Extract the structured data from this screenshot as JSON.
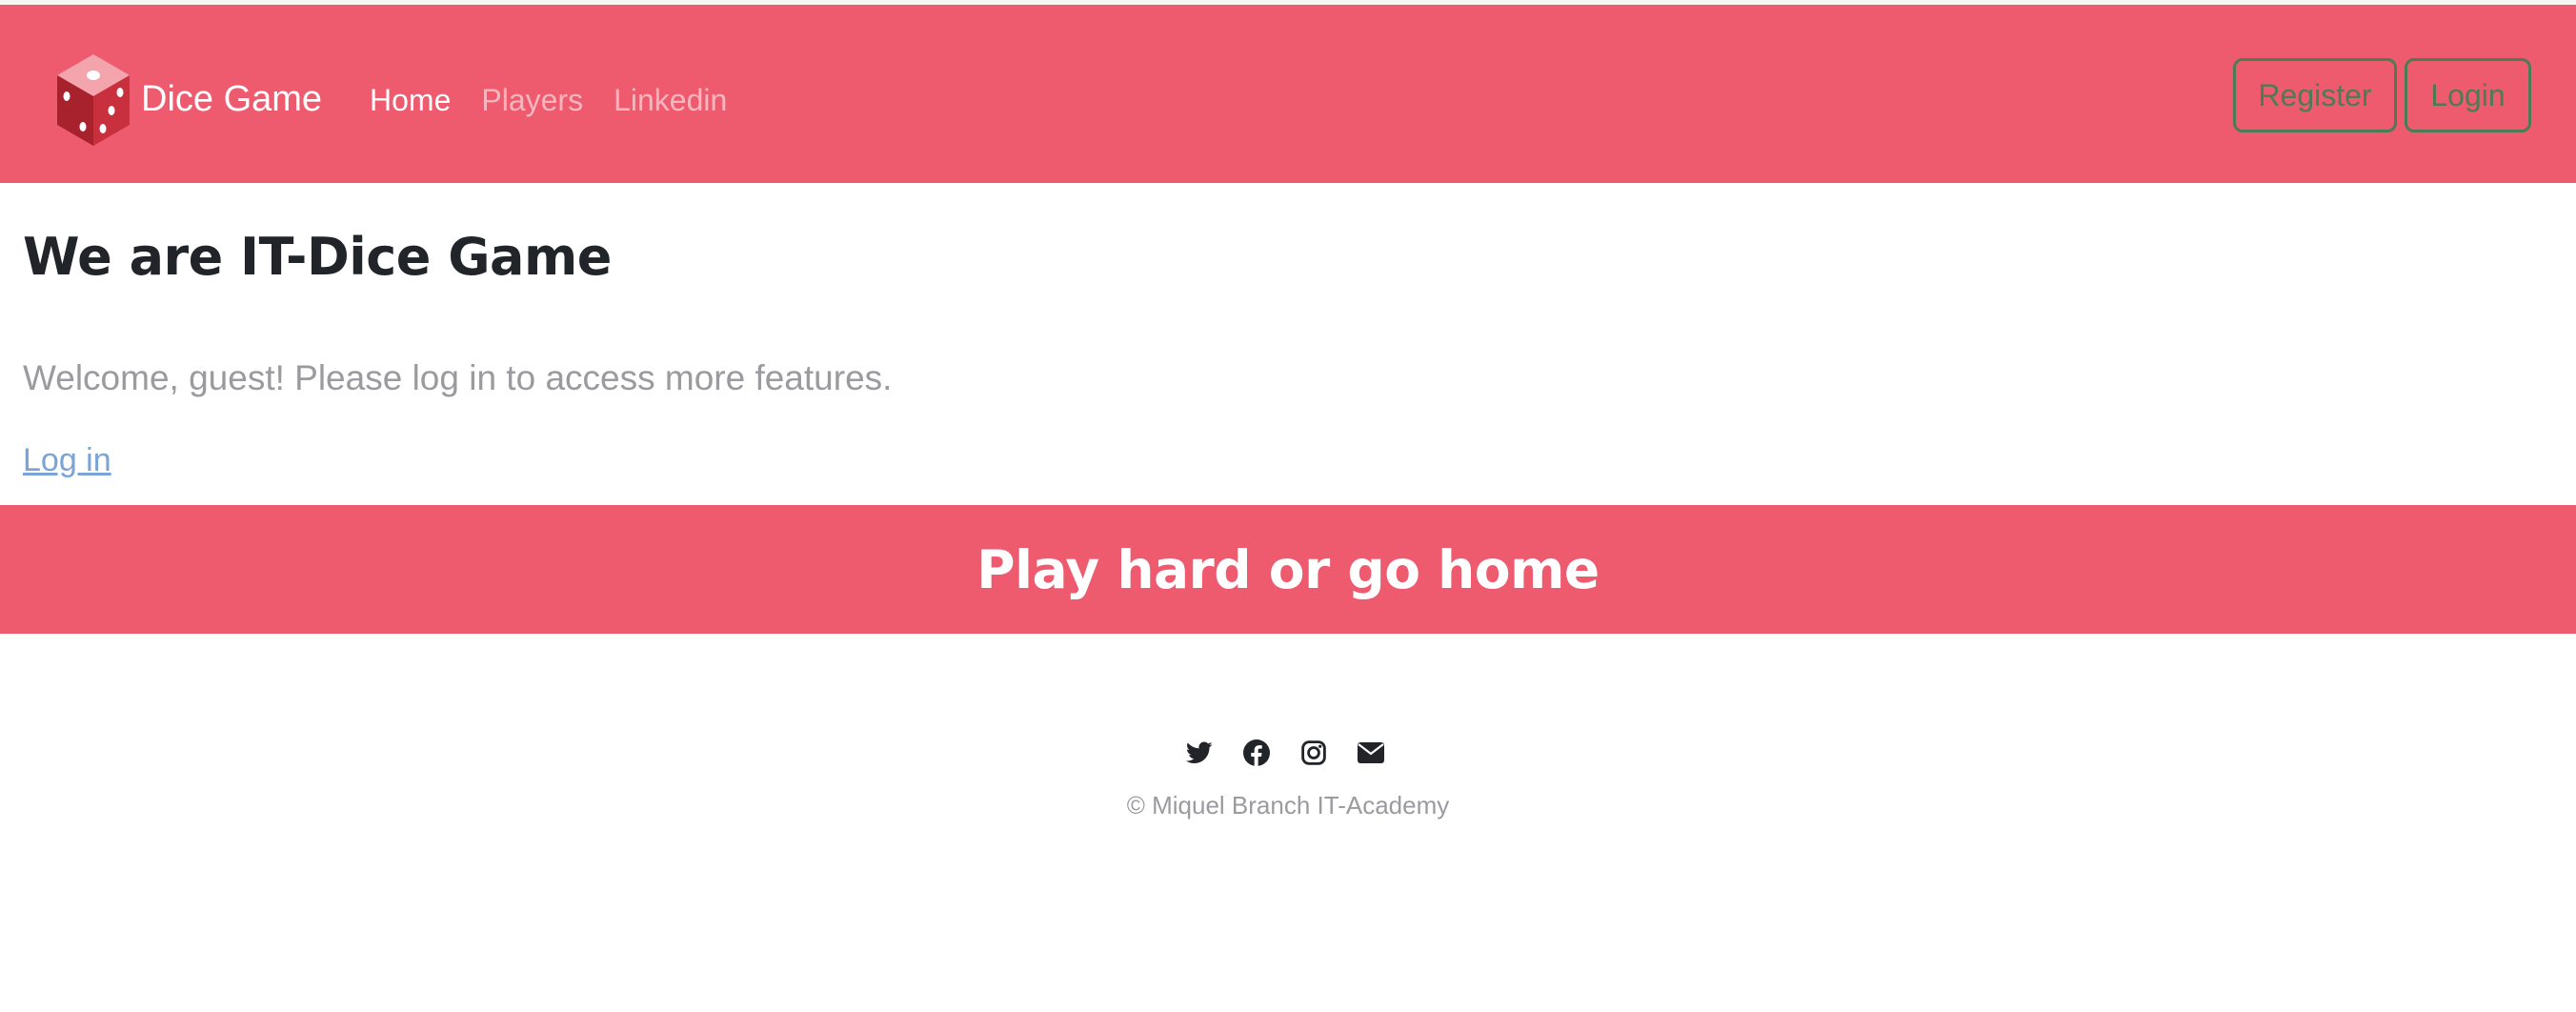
{
  "brand": {
    "name": "Dice Game",
    "logo_icon": "dice-icon"
  },
  "nav": {
    "links": [
      {
        "label": "Home",
        "active": true
      },
      {
        "label": "Players",
        "active": false
      },
      {
        "label": "Linkedin",
        "active": false
      }
    ],
    "register_label": "Register",
    "login_label": "Login"
  },
  "main": {
    "heading": "We are IT-Dice Game",
    "welcome": "Welcome, guest! Please log in to access more features.",
    "login_link": "Log in"
  },
  "banner": {
    "text": "Play hard or go home"
  },
  "footer": {
    "icons": [
      "twitter-icon",
      "facebook-icon",
      "instagram-icon",
      "envelope-icon"
    ],
    "copyright": "© Miquel Branch IT-Academy"
  },
  "colors": {
    "accent": "#ee5b6f",
    "button_border": "#4d7b55",
    "heading": "#212529",
    "muted_text": "#9a9a9f",
    "link": "#7aa3d6"
  }
}
